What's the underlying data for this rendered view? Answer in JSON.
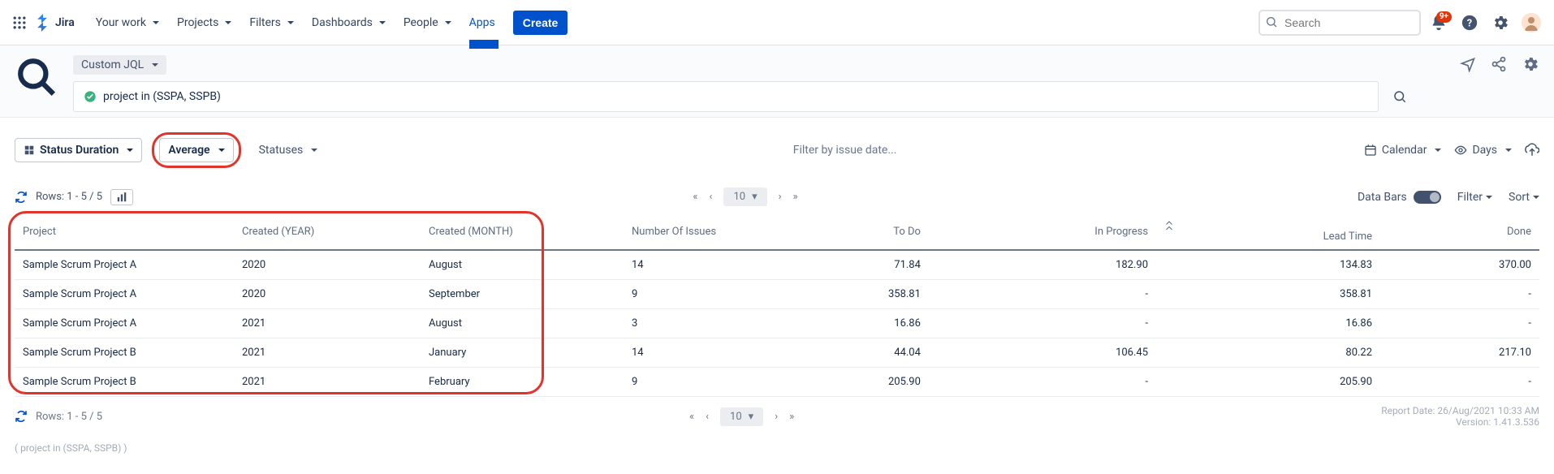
{
  "top": {
    "product": "Jira",
    "nav": {
      "your_work": "Your work",
      "projects": "Projects",
      "filters": "Filters",
      "dashboards": "Dashboards",
      "people": "People",
      "apps": "Apps"
    },
    "create": "Create",
    "search_placeholder": "Search",
    "notif_badge": "9+"
  },
  "report": {
    "jql_mode": "Custom JQL",
    "jql_query": "project in (SSPA, SSPB)"
  },
  "toolbar": {
    "status_duration": "Status Duration",
    "average": "Average",
    "statuses": "Statuses",
    "filter_placeholder": "Filter by issue date...",
    "calendar": "Calendar",
    "days": "Days"
  },
  "rows_meta": {
    "rows_label_top": "Rows: 1 - 5 / 5",
    "rows_label_bottom": "Rows: 1 - 5 / 5",
    "page_size": "10",
    "data_bars": "Data Bars",
    "filter": "Filter",
    "sort": "Sort"
  },
  "table": {
    "headers": {
      "project": "Project",
      "created_year": "Created (YEAR)",
      "created_month": "Created (MONTH)",
      "num_issues": "Number Of Issues",
      "todo": "To Do",
      "in_progress": "In Progress",
      "lead_time": "Lead Time",
      "done": "Done"
    },
    "rows": [
      {
        "project": "Sample Scrum Project A",
        "year": "2020",
        "month": "August",
        "issues": "14",
        "todo": "71.84",
        "in_progress": "182.90",
        "lead": "134.83",
        "done": "370.00"
      },
      {
        "project": "Sample Scrum Project A",
        "year": "2020",
        "month": "September",
        "issues": "9",
        "todo": "358.81",
        "in_progress": "-",
        "lead": "358.81",
        "done": "-"
      },
      {
        "project": "Sample Scrum Project A",
        "year": "2021",
        "month": "August",
        "issues": "3",
        "todo": "16.86",
        "in_progress": "-",
        "lead": "16.86",
        "done": "-"
      },
      {
        "project": "Sample Scrum Project B",
        "year": "2021",
        "month": "January",
        "issues": "14",
        "todo": "44.04",
        "in_progress": "106.45",
        "lead": "80.22",
        "done": "217.10"
      },
      {
        "project": "Sample Scrum Project B",
        "year": "2021",
        "month": "February",
        "issues": "9",
        "todo": "205.90",
        "in_progress": "-",
        "lead": "205.90",
        "done": "-"
      }
    ]
  },
  "footer": {
    "report_date": "Report Date: 26/Aug/2021 10:33 AM",
    "version": "Version: 1.41.3.536",
    "query_echo": "( project in (SSPA, SSPB) )"
  }
}
